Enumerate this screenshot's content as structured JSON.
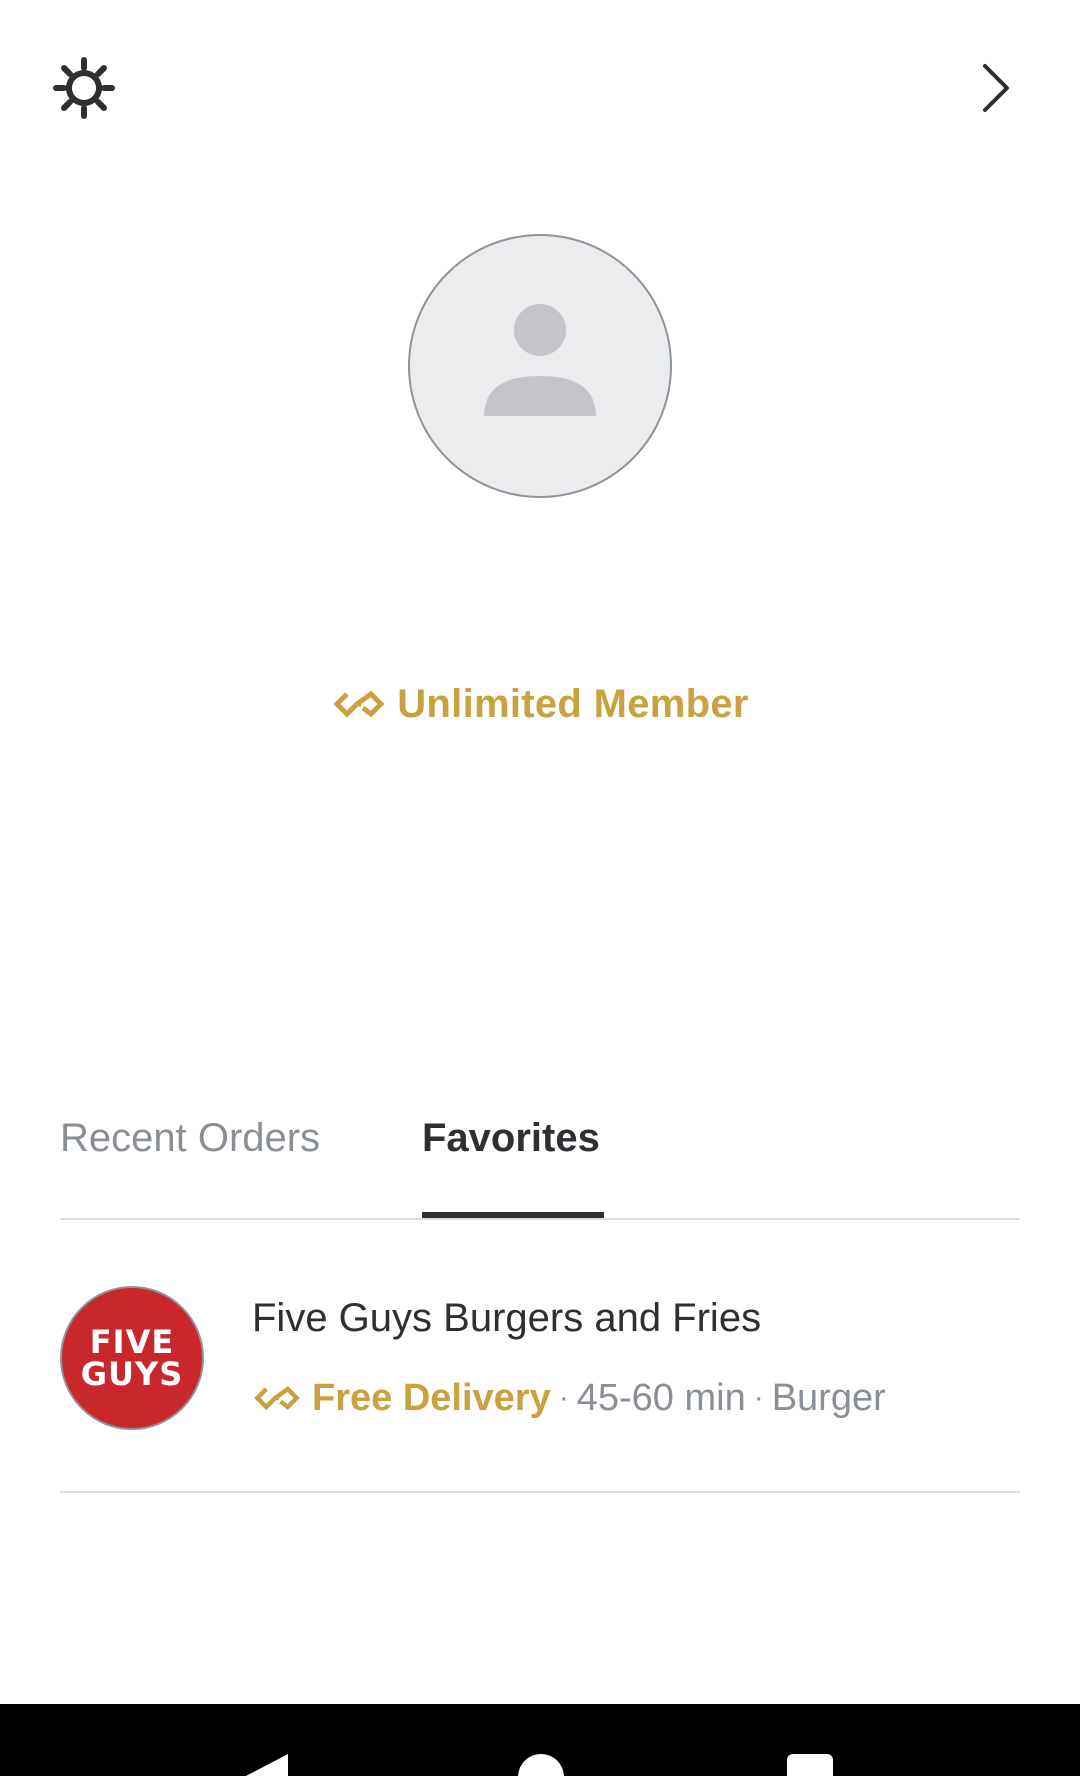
{
  "header": {
    "settings_icon": "gear-icon",
    "next_icon": "chevron-right-icon"
  },
  "profile": {
    "avatar_icon": "person-placeholder-icon",
    "name": "",
    "membership_icon": "dashpass-icon",
    "membership_label": "Unlimited Member"
  },
  "tabs": [
    {
      "label": "Recent Orders",
      "selected": false
    },
    {
      "label": "Favorites",
      "selected": true
    }
  ],
  "favorites": [
    {
      "logo_line1": "FIVE",
      "logo_line2": "GUYS",
      "name": "Five Guys Burgers and Fries",
      "delivery_label": "Free Delivery",
      "separator": "·",
      "eta": "45-60 min",
      "cuisine": "Burger"
    }
  ],
  "colors": {
    "gold": "#c9a13e",
    "text_dark": "#2d2f33",
    "text_grey": "#8a8f96",
    "logo_red": "#c8282c"
  },
  "navbar": {
    "back_icon": "back-triangle-icon",
    "home_icon": "home-circle-icon",
    "recents_icon": "recents-square-icon"
  }
}
